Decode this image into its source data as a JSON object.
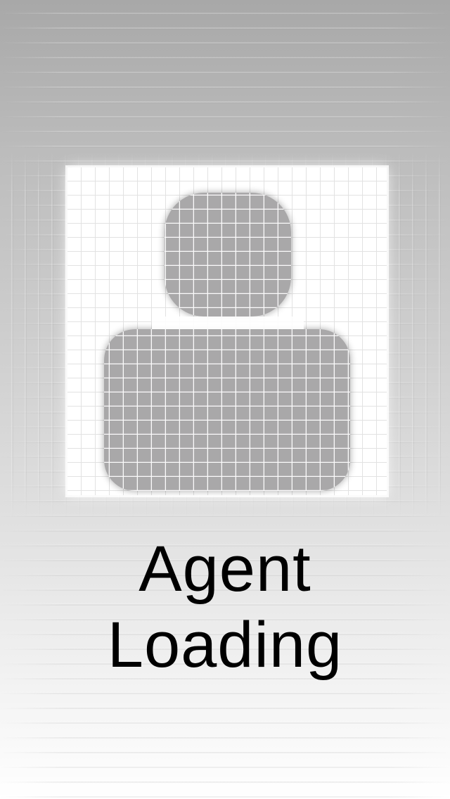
{
  "screen": {
    "title_line_1": "Agent",
    "title_line_2": "Loading"
  },
  "avatar": {
    "icon": "person-silhouette-icon"
  },
  "colors": {
    "background_top": "#a8a8a8",
    "background_bottom": "#ffffff",
    "frame": "#ffffff",
    "silhouette": "#a9a8a9",
    "text": "#000000"
  }
}
